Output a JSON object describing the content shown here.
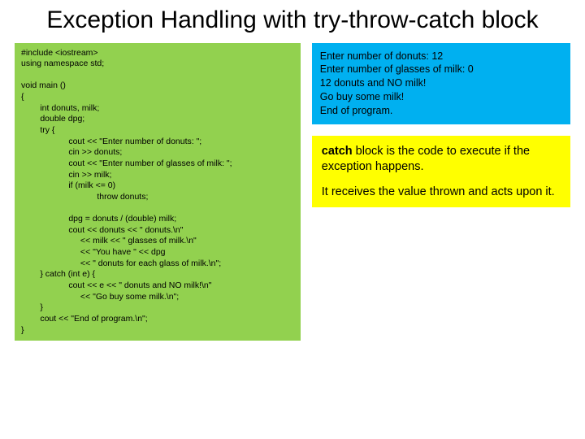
{
  "title": "Exception Handling with try-throw-catch block",
  "code": "#include <iostream>\nusing namespace std;\n\nvoid main ()\n{\n        int donuts, milk;\n        double dpg;\n        try {\n                    cout << \"Enter number of donuts: \";\n                    cin >> donuts;\n                    cout << \"Enter number of glasses of milk: \";\n                    cin >> milk;\n                    if (milk <= 0)\n                                throw donuts;\n\n                    dpg = donuts / (double) milk;\n                    cout << donuts << \" donuts.\\n\"\n                         << milk << \" glasses of milk.\\n\"\n                         << \"You have \" << dpg\n                         << \" donuts for each glass of milk.\\n\";\n        } catch (int e) {\n                    cout << e << \" donuts and NO milk!\\n\"\n                         << \"Go buy some milk.\\n\";\n        }\n        cout << \"End of program.\\n\";\n}",
  "output": "Enter number of donuts: 12\nEnter number of glasses of milk: 0\n12 donuts and NO milk!\nGo buy some milk!\nEnd of program.",
  "note": {
    "kw": "catch",
    "p1_rest": " block is the code to execute  if the exception happens.",
    "p2": "It receives the value thrown and acts upon it."
  }
}
